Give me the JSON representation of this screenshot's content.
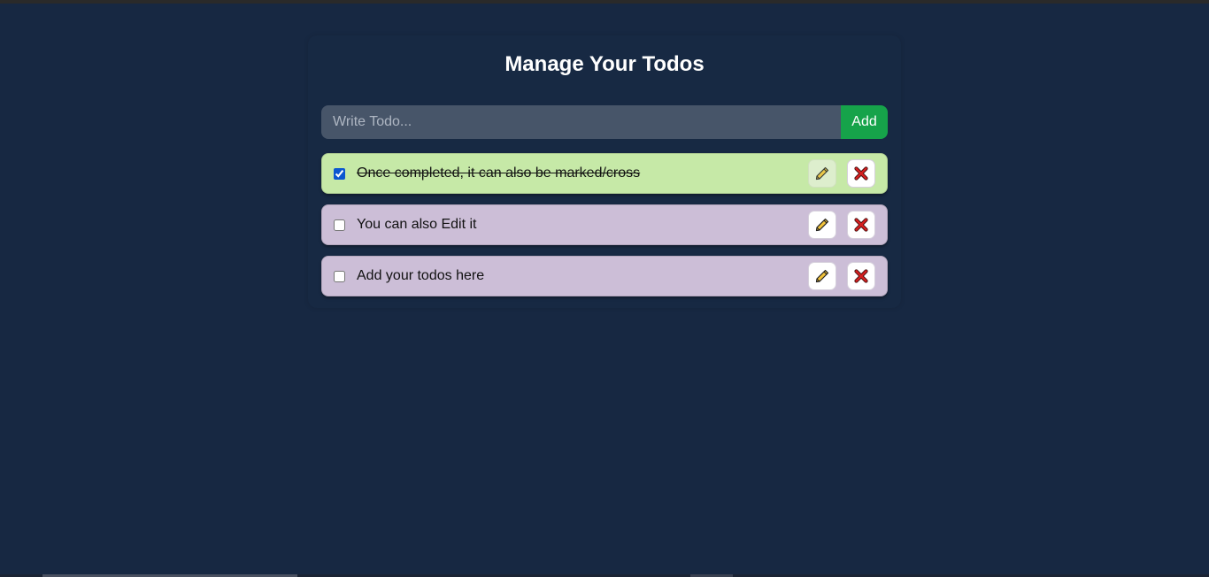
{
  "header": {
    "title": "Manage Your Todos"
  },
  "form": {
    "placeholder": "Write Todo...",
    "add_label": "Add"
  },
  "todos": [
    {
      "text": "Once completed, it can also be marked/cross",
      "completed": true,
      "color": "#c6e9a7"
    },
    {
      "text": "You can also Edit it",
      "completed": false,
      "color": "#ccbed7"
    },
    {
      "text": "Add your todos here",
      "completed": false,
      "color": "#ccbed7"
    }
  ],
  "icons": {
    "edit": "pencil-icon",
    "delete": "close-icon"
  },
  "colors": {
    "background": "#172842",
    "accent": "#16a34a",
    "input": "#475569"
  }
}
